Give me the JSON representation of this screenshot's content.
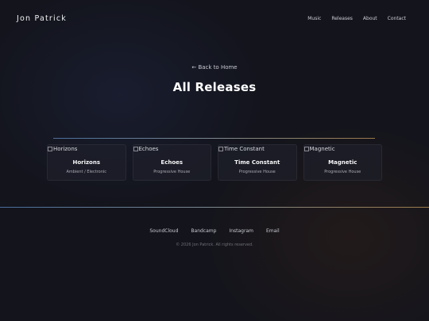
{
  "site": {
    "brand": "Jon Patrick"
  },
  "nav": {
    "items": [
      {
        "label": "Music"
      },
      {
        "label": "Releases"
      },
      {
        "label": "About"
      },
      {
        "label": "Contact"
      }
    ]
  },
  "page": {
    "back_arrow": "←",
    "back_label": "Back to Home",
    "title": "All Releases"
  },
  "releases": [
    {
      "image_alt": "Horizons",
      "title": "Horizons",
      "genre": "Ambient / Electronic"
    },
    {
      "image_alt": "Echoes",
      "title": "Echoes",
      "genre": "Progressive House"
    },
    {
      "image_alt": "Time Constant",
      "title": "Time Constant",
      "genre": "Progressive House"
    },
    {
      "image_alt": "Magnetic",
      "title": "Magnetic",
      "genre": "Progressive House"
    }
  ],
  "footer": {
    "links": [
      {
        "label": "SoundCloud"
      },
      {
        "label": "Bandcamp"
      },
      {
        "label": "Instagram"
      },
      {
        "label": "Email"
      }
    ],
    "copyright": "© 2026 Jon Patrick. All rights reserved."
  },
  "colors": {
    "background": "#13141c",
    "accent_blue": "#4a6f9c",
    "accent_gold": "#9a7a4a"
  }
}
